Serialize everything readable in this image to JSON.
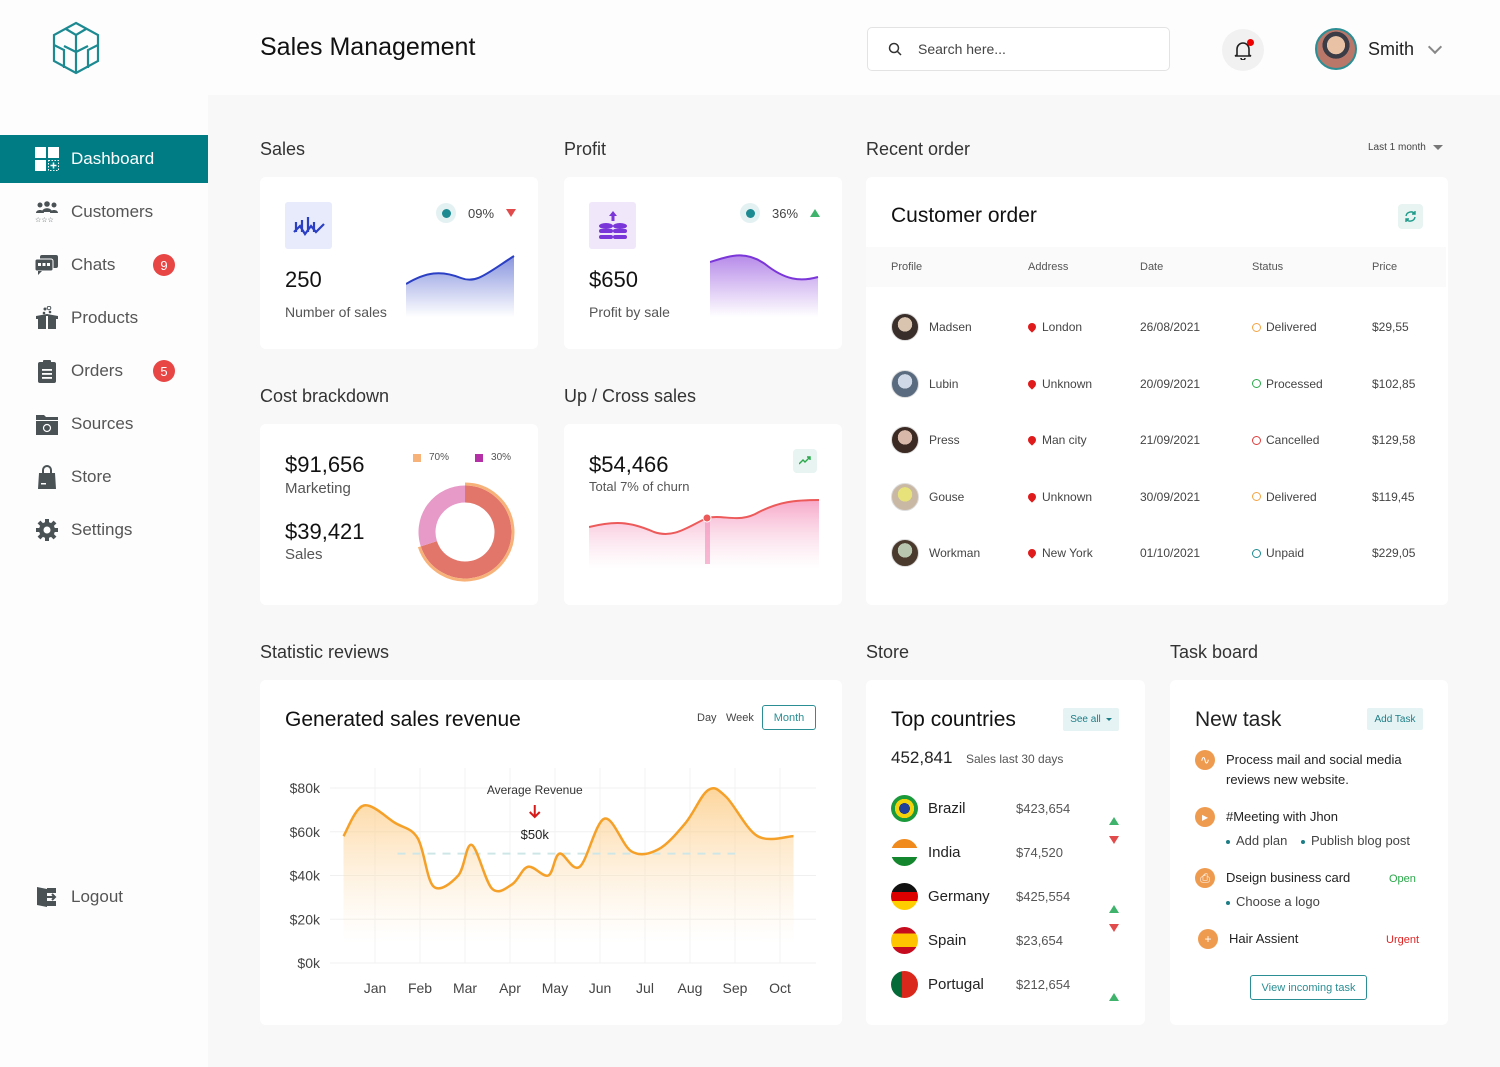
{
  "app": {
    "title": "Sales Management"
  },
  "search": {
    "placeholder": "Search here..."
  },
  "user": {
    "name": "Smith"
  },
  "sidebar": {
    "items": [
      {
        "label": "Dashboard",
        "icon": "dashboard-icon",
        "active": true
      },
      {
        "label": "Customers",
        "icon": "customers-icon"
      },
      {
        "label": "Chats",
        "icon": "chats-icon",
        "badge": "9"
      },
      {
        "label": "Products",
        "icon": "products-icon"
      },
      {
        "label": "Orders",
        "icon": "orders-icon",
        "badge": "5"
      },
      {
        "label": "Sources",
        "icon": "sources-icon"
      },
      {
        "label": "Store",
        "icon": "store-icon"
      },
      {
        "label": "Settings",
        "icon": "settings-icon"
      }
    ],
    "logout": "Logout"
  },
  "sales": {
    "section": "Sales",
    "value": "250",
    "label": "Number of sales",
    "percent": "09%",
    "trend": "down",
    "color": "#2a3fc4"
  },
  "profit": {
    "section": "Profit",
    "value": "$650",
    "label": "Profit by sale",
    "percent": "36%",
    "trend": "up",
    "color": "#7a36d8"
  },
  "cost": {
    "section": "Cost brackdown",
    "marketing_value": "$91,656",
    "marketing_label": "Marketing",
    "sales_value": "$39,421",
    "sales_label": "Sales",
    "legend": [
      {
        "label": "70%",
        "color": "#f7b27a"
      },
      {
        "label": "30%",
        "color": "#b52fa6"
      }
    ],
    "shares": [
      70,
      30
    ]
  },
  "cross": {
    "section": "Up / Cross sales",
    "value": "$54,466",
    "label": "Total 7% of churn"
  },
  "orders": {
    "section": "Recent order",
    "filter": "Last 1 month",
    "title": "Customer order",
    "columns": [
      "Profile",
      "Address",
      "Date",
      "Status",
      "Price"
    ],
    "rows": [
      {
        "name": "Madsen",
        "address": "London",
        "date": "26/08/2021",
        "status": "Delivered",
        "price": "$29,55"
      },
      {
        "name": "Lubin",
        "address": "Unknown",
        "date": "20/09/2021",
        "status": "Processed",
        "price": "$102,85"
      },
      {
        "name": "Press",
        "address": "Man city",
        "date": "21/09/2021",
        "status": "Cancelled",
        "price": "$129,58"
      },
      {
        "name": "Gouse",
        "address": "Unknown",
        "date": "30/09/2021",
        "status": "Delivered",
        "price": "$119,45"
      },
      {
        "name": "Workman",
        "address": "New York",
        "date": "01/10/2021",
        "status": "Unpaid",
        "price": "$229,05"
      }
    ],
    "status_colors": {
      "Delivered": "#f5a442",
      "Processed": "#2aa84a",
      "Cancelled": "#e23b3b",
      "Unpaid": "#1d8a92"
    }
  },
  "stats": {
    "section": "Statistic reviews",
    "title": "Generated sales revenue",
    "tabs": [
      "Day",
      "Week",
      "Month"
    ],
    "active_tab": "Month",
    "annotation": "Average Revenue",
    "annotation_value": "$50k"
  },
  "chart_data": {
    "type": "area",
    "title": "Generated sales revenue",
    "categories": [
      "Jan",
      "Feb",
      "Mar",
      "Apr",
      "May",
      "Jun",
      "Jul",
      "Aug",
      "Sep",
      "Oct"
    ],
    "x": [
      0.3,
      0.75,
      1.45,
      1.95,
      2.3,
      2.85,
      3.15,
      3.6,
      4.05,
      4.4,
      4.85,
      5.1,
      5.55,
      6.1,
      6.7,
      7.3,
      7.9,
      8.4,
      8.8,
      9.5,
      10.3
    ],
    "values": [
      58,
      72,
      64,
      57,
      35,
      40,
      54,
      34,
      36,
      44,
      40,
      50,
      44,
      66,
      51,
      52,
      64,
      79,
      76,
      58,
      58
    ],
    "avg_line": 50,
    "ylim": [
      0,
      80
    ],
    "yticks": [
      "$0k",
      "$20k",
      "$40k",
      "$60k",
      "$80k"
    ],
    "ylabel": "",
    "xlabel": "",
    "grid": true,
    "color": "#f5a028"
  },
  "store": {
    "section": "Store",
    "title": "Top countries",
    "see_all": "See all",
    "total": "452,841",
    "total_label": "Sales last 30 days",
    "countries": [
      {
        "name": "Brazil",
        "value": "$423,654",
        "trend": "up"
      },
      {
        "name": "India",
        "value": "$74,520",
        "trend": "down"
      },
      {
        "name": "Germany",
        "value": "$425,554",
        "trend": "up"
      },
      {
        "name": "Spain",
        "value": "$23,654",
        "trend": "down"
      },
      {
        "name": "Portugal",
        "value": "$212,654",
        "trend": "up"
      }
    ]
  },
  "tasks": {
    "section": "Task board",
    "title": "New task",
    "add": "Add Task",
    "items": [
      {
        "title": "Process mail and social media reviews new website.",
        "icon": "activity-icon"
      },
      {
        "title": "#Meeting with Jhon",
        "icon": "video-icon",
        "subs": [
          "Add plan",
          "Publish blog post"
        ]
      },
      {
        "title": "Dseign business card",
        "icon": "printer-icon",
        "tag": "Open",
        "subs": [
          "Choose a logo"
        ]
      },
      {
        "title": "Hair Assient",
        "icon": "plus-icon",
        "tag": "Urgent"
      }
    ],
    "view": "View incoming task"
  }
}
